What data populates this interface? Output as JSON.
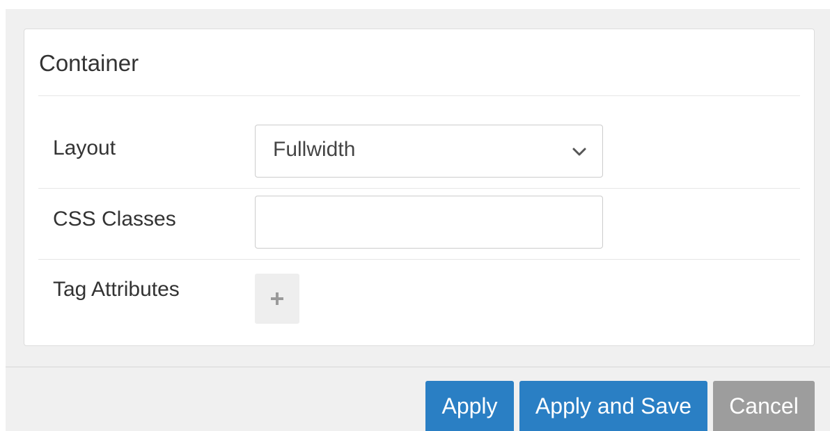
{
  "panel": {
    "title": "Container"
  },
  "fields": {
    "layout": {
      "label": "Layout",
      "value": "Fullwidth"
    },
    "css_classes": {
      "label": "CSS Classes",
      "value": ""
    },
    "tag_attributes": {
      "label": "Tag Attributes",
      "add_icon": "+"
    }
  },
  "footer": {
    "apply_label": "Apply",
    "apply_save_label": "Apply and Save",
    "cancel_label": "Cancel"
  },
  "colors": {
    "primary_button": "#2a7fc4",
    "cancel_button": "#9d9d9d",
    "dialog_background": "#f0f0f0"
  }
}
